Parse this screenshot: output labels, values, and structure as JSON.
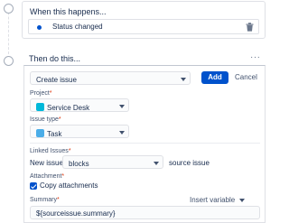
{
  "trigger": {
    "heading": "When this happens...",
    "status_label": "Status changed",
    "icons": {
      "node": "circle-node-icon",
      "status": "status-dot-icon",
      "delete": "trash-icon"
    }
  },
  "action": {
    "heading": "Then do this...",
    "menu_icon": "more-dots-icon",
    "type_value": "Create issue",
    "add_label": "Add",
    "cancel_label": "Cancel",
    "project": {
      "label": "Project",
      "required": "*",
      "value": "Service Desk",
      "icon": "service-desk-icon"
    },
    "issue_type": {
      "label": "Issue type",
      "required": "*",
      "value": "Task",
      "icon": "task-checkbox-icon"
    },
    "linked_issues": {
      "label": "Linked Issues",
      "required": "*",
      "prefix": "New issue",
      "link_type": "blocks",
      "suffix": "source issue"
    },
    "attachment": {
      "label": "Attachment",
      "required": "*",
      "option_label": "Copy attachments",
      "checked": true
    },
    "summary": {
      "label": "Summary",
      "required": "*",
      "insert_label": "Insert variable",
      "value": "${sourceissue.summary}"
    }
  },
  "colors": {
    "accent": "#0052cc",
    "required": "#de350b",
    "border": "#dfe1e6",
    "text": "#172b4d"
  }
}
